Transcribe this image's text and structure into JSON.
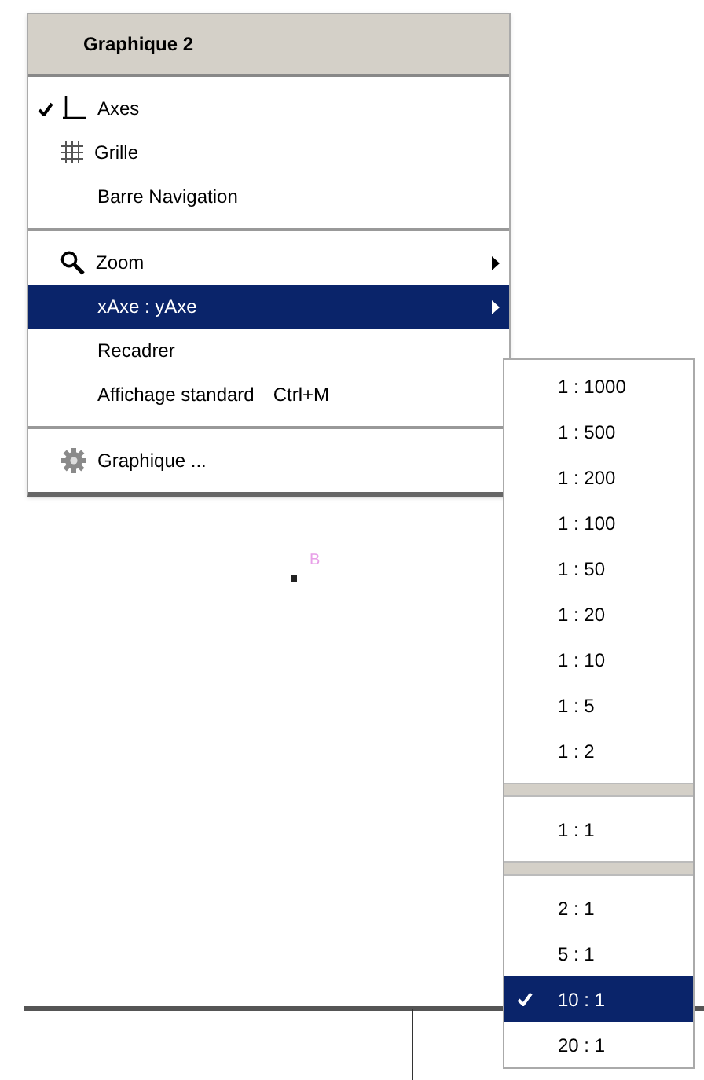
{
  "menu": {
    "title": "Graphique 2",
    "groups": [
      [
        {
          "label": "Axes",
          "checked": true,
          "selected": false,
          "submenu": false
        },
        {
          "label": "Grille",
          "checked": false,
          "selected": false,
          "submenu": false
        },
        {
          "label": "Barre Navigation",
          "checked": false,
          "selected": false,
          "submenu": false
        }
      ],
      [
        {
          "label": "Zoom",
          "checked": false,
          "selected": false,
          "submenu": true
        },
        {
          "label": "xAxe : yAxe",
          "checked": false,
          "selected": true,
          "submenu": true
        },
        {
          "label": "Recadrer",
          "checked": false,
          "selected": false,
          "submenu": false
        },
        {
          "label": "Affichage standard",
          "shortcut": "Ctrl+M",
          "checked": false,
          "selected": false,
          "submenu": false
        }
      ],
      [
        {
          "label": "Graphique ...",
          "checked": false,
          "selected": false,
          "submenu": false
        }
      ]
    ]
  },
  "submenu": {
    "groups": [
      [
        {
          "label": "1 : 1000",
          "checked": false,
          "selected": false
        },
        {
          "label": "1 : 500",
          "checked": false,
          "selected": false
        },
        {
          "label": "1 : 200",
          "checked": false,
          "selected": false
        },
        {
          "label": "1 : 100",
          "checked": false,
          "selected": false
        },
        {
          "label": "1 : 50",
          "checked": false,
          "selected": false
        },
        {
          "label": "1 : 20",
          "checked": false,
          "selected": false
        },
        {
          "label": "1 : 10",
          "checked": false,
          "selected": false
        },
        {
          "label": "1 : 5",
          "checked": false,
          "selected": false
        },
        {
          "label": "1 : 2",
          "checked": false,
          "selected": false
        }
      ],
      [
        {
          "label": "1 : 1",
          "checked": false,
          "selected": false
        }
      ],
      [
        {
          "label": "2 : 1",
          "checked": false,
          "selected": false
        },
        {
          "label": "5 : 1",
          "checked": false,
          "selected": false
        },
        {
          "label": "10 : 1",
          "checked": true,
          "selected": true
        },
        {
          "label": "20 : 1",
          "checked": false,
          "selected": false
        }
      ]
    ]
  },
  "canvas": {
    "point_label": "B"
  }
}
